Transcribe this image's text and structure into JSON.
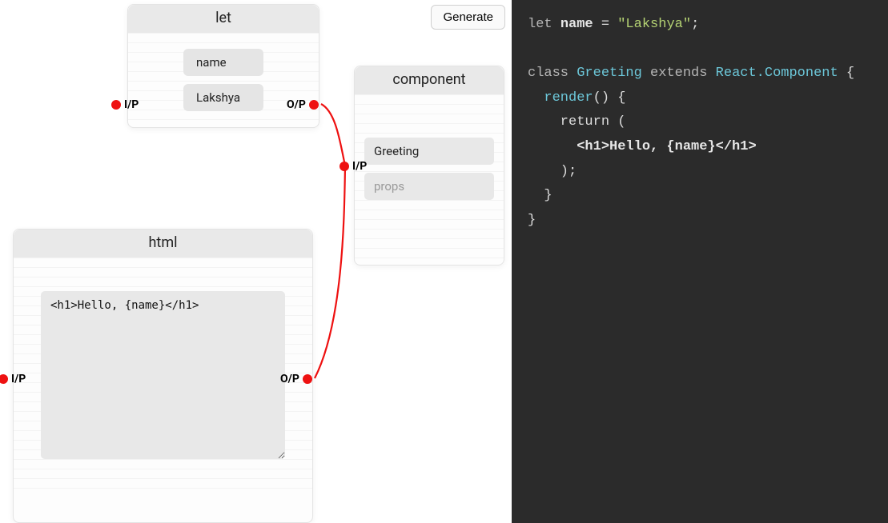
{
  "toolbar": {
    "generate_label": "Generate"
  },
  "ports": {
    "input_label": "I/P",
    "output_label": "O/P"
  },
  "nodes": {
    "let": {
      "title": "let",
      "field_name": "name",
      "field_value": "Lakshya"
    },
    "html": {
      "title": "html",
      "content": "<h1>Hello, {name}</h1>"
    },
    "component": {
      "title": "component",
      "name_value": "Greeting",
      "props_placeholder": "props"
    }
  },
  "code": {
    "line1_kw": "let",
    "line1_id": "name",
    "line1_eq": " = ",
    "line1_str": "\"Lakshya\"",
    "line1_semi": ";",
    "blank": "",
    "line3_kw": "class",
    "line3_cls": " Greeting",
    "line3_ext": " extends",
    "line3_super": " React.Component",
    "line3_brace": " {",
    "line4_indent": "  ",
    "line4_fn": "render",
    "line4_rest": "() {",
    "line5": "    return (",
    "line6": "      <h1>Hello, {name}</h1>",
    "line7": "    );",
    "line8": "  }",
    "line9": "}"
  }
}
